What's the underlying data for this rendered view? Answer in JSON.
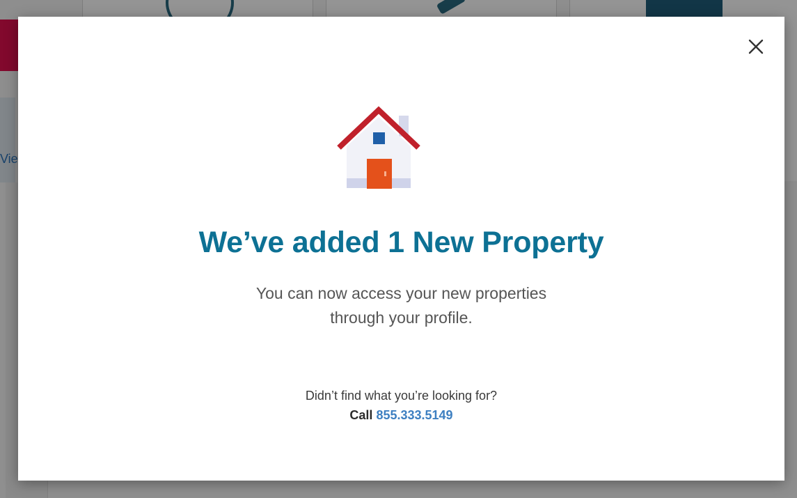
{
  "background": {
    "link_fragment": "Vie"
  },
  "modal": {
    "close_icon": "close-icon",
    "house_icon": "house-icon",
    "title": "We’ve added 1 New Property",
    "subtitle_line1": "You can now access your new properties",
    "subtitle_line2": "through your profile.",
    "help_question": "Didn’t find what you’re looking for?",
    "call_label": "Call",
    "phone": "855.333.5149"
  },
  "colors": {
    "title": "#0d7194",
    "phone_link": "#3d7fc1",
    "roof": "#c0212b",
    "door": "#e4511b",
    "window": "#1f5fa8",
    "house_wall": "#f1f2f8",
    "house_base": "#cfd3ea"
  }
}
